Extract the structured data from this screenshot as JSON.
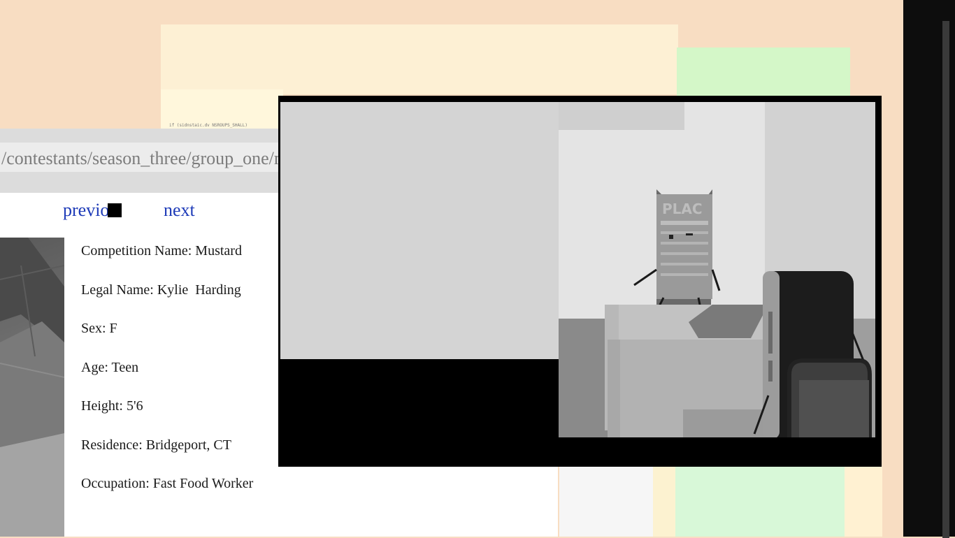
{
  "browser": {
    "url": "/contestants/season_three/group_one/mustard",
    "code_snippet": "if (sidnstaic.dv NSROUPS_SHALL)"
  },
  "nav": {
    "previous_label": "previo",
    "next_label": "next"
  },
  "profile": {
    "fields": [
      {
        "label": "Competition Name",
        "value": "Mustard",
        "text": "Competition Name: Mustard"
      },
      {
        "label": "Legal Name",
        "value": "Kylie  Harding",
        "text": "Legal Name: Kylie  Harding"
      },
      {
        "label": "Sex",
        "value": "F",
        "text": "Sex: F"
      },
      {
        "label": "Age",
        "value": "Teen",
        "text": "Age: Teen"
      },
      {
        "label": "Height",
        "value": "5'6",
        "text": "Height: 5'6"
      },
      {
        "label": "Residence",
        "value": "Bridgeport, CT",
        "text": "Residence: Bridgeport, CT"
      },
      {
        "label": "Occupation",
        "value": "Fast Food Worker",
        "text": "Occupation: Fast Food Worker"
      }
    ]
  },
  "video": {
    "sign_text": "PLAC"
  },
  "colors": {
    "link": "#1e3bb8",
    "url_text": "#7c7c7c",
    "background": "#f8ddc2"
  }
}
